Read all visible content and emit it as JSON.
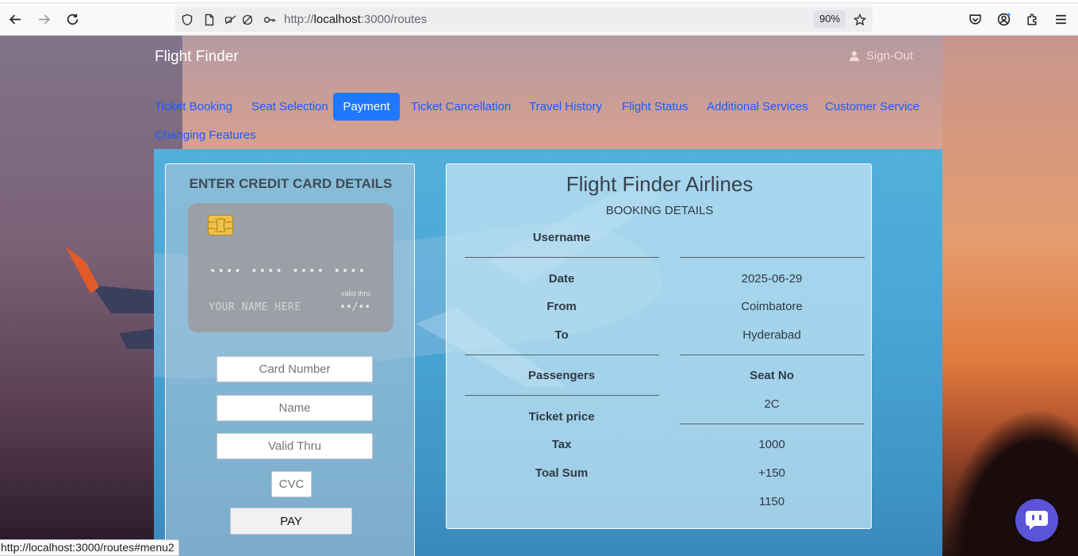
{
  "browser": {
    "url_prefix": "http://",
    "url_host": "localhost",
    "url_path": ":3000/routes",
    "zoom": "90%",
    "status_url": "http://localhost:3000/routes#menu2"
  },
  "header": {
    "brand": "Flight Finder",
    "signout_label": "Sign-Out"
  },
  "nav": {
    "items": [
      {
        "label": "Ticket Booking"
      },
      {
        "label": "Seat Selection"
      },
      {
        "label": "Payment",
        "active": true
      },
      {
        "label": "Ticket Cancellation"
      },
      {
        "label": "Travel History"
      },
      {
        "label": "Flight Status"
      },
      {
        "label": "Additional Services"
      },
      {
        "label": "Customer Service"
      },
      {
        "label": "Changing Features"
      }
    ]
  },
  "payment": {
    "title": "ENTER CREDIT CARD DETAILS",
    "card_preview": {
      "number": "•••• •••• •••• ••••",
      "name": "YOUR NAME HERE",
      "valid_label": "valid thru",
      "valid": "••/••"
    },
    "fields": {
      "card_number_placeholder": "Card Number",
      "name_placeholder": "Name",
      "valid_thru_placeholder": "Valid Thru",
      "cvc_placeholder": "CVC"
    },
    "pay_label": "PAY"
  },
  "booking": {
    "title": "Flight Finder Airlines",
    "subtitle": "BOOKING DETAILS",
    "labels": {
      "username": "Username",
      "date": "Date",
      "from": "From",
      "to": "To",
      "passengers": "Passengers",
      "ticket_price": "Ticket price",
      "tax": "Tax",
      "total": "Toal Sum"
    },
    "values": {
      "username": "",
      "date": "2025-06-29",
      "from": "Coimbatore",
      "to": "Hyderabad",
      "seat_label": "Seat No",
      "seat": "2C",
      "price": "1000",
      "tax": "+150",
      "total": "1150"
    }
  },
  "colors": {
    "accent": "#1f78ff",
    "link": "#1a5cff",
    "panel": "#4aa6d6",
    "chat": "#5b54d9"
  }
}
